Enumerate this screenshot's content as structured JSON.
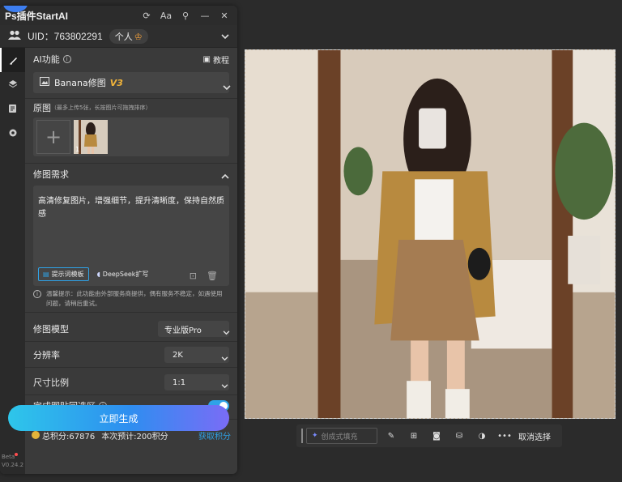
{
  "plugin": {
    "title": "Ps插件StartAI",
    "uid": "UID：763802291",
    "badge": "个人",
    "ai_function_label": "AI功能",
    "tutorial_label": "教程",
    "model_name": "Banana修图",
    "model_version": "V3",
    "original_label": "原图",
    "original_hint": "（最多上传5张，长按图片可拖拽排序）",
    "thumb_count": "1",
    "request_label": "修图需求",
    "request_text": "高清修复图片，增强细节，提升清晰度，保持自然质感",
    "prompt_template_btn": "提示词模板",
    "deepseek_btn": "DeepSeek扩写",
    "warm_tip": "温馨提示：此功能由外部服务商提供，偶有服务不稳定，如遇使用问题，请稍后重试。",
    "model_label": "修图模型",
    "model_value": "专业版Pro",
    "resolution_label": "分辨率",
    "resolution_value": "2K",
    "ratio_label": "尺寸比例",
    "ratio_value": "1:1",
    "paste_back_label": "完成图贴回选区",
    "paste_back_on": true,
    "points_total": "总积分:67876",
    "points_estimate": "本次预计:200积分",
    "get_points": "获取积分",
    "generate_btn": "立即生成",
    "version_beta": "Beta",
    "version_num": "V0.24.2",
    "accent_color": "#2fa3e8"
  },
  "toolbar": {
    "fill_placeholder": "创成式填充",
    "cancel_selection": "取消选择"
  }
}
